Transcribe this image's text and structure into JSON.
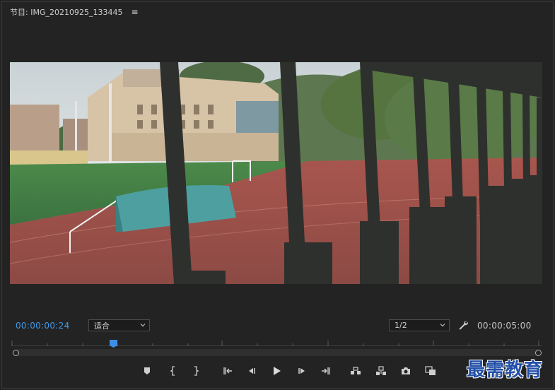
{
  "header": {
    "title": "节目: IMG_20210925_133445",
    "menu_icon": "hamburger-menu-icon"
  },
  "viewer": {
    "content": "video-frame"
  },
  "controls": {
    "current_timecode": "00:00:00:24",
    "fit_value": "适合",
    "resolution_value": "1/2",
    "duration_timecode": "00:00:05:00",
    "settings_icon": "wrench-icon"
  },
  "transport": {
    "buttons": [
      {
        "name": "add-marker-button",
        "icon": "marker-icon"
      },
      {
        "name": "mark-in-button",
        "icon": "mark-in-icon"
      },
      {
        "name": "mark-out-button",
        "icon": "mark-out-icon"
      },
      {
        "name": "go-to-in-button",
        "icon": "go-to-in-icon"
      },
      {
        "name": "step-back-button",
        "icon": "step-back-icon"
      },
      {
        "name": "play-button",
        "icon": "play-icon"
      },
      {
        "name": "step-forward-button",
        "icon": "step-forward-icon"
      },
      {
        "name": "go-to-out-button",
        "icon": "go-to-out-icon"
      },
      {
        "name": "lift-button",
        "icon": "lift-icon"
      },
      {
        "name": "extract-button",
        "icon": "extract-icon"
      },
      {
        "name": "export-frame-button",
        "icon": "camera-icon"
      },
      {
        "name": "comparison-view-button",
        "icon": "comparison-icon"
      }
    ]
  },
  "watermark": {
    "text": "最需教育"
  },
  "colors": {
    "accent": "#3d9ae8",
    "panel_bg": "#232323",
    "watermark": "#2350a8"
  }
}
